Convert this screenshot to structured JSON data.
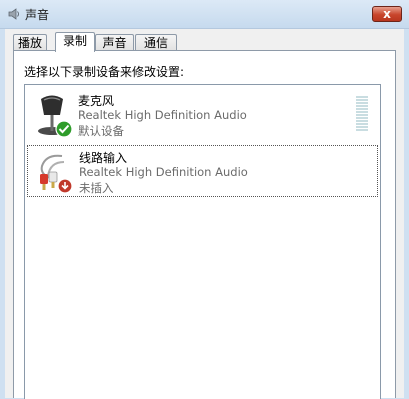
{
  "window": {
    "title": "声音",
    "close_glyph": "x"
  },
  "tabs": [
    {
      "label": "播放",
      "active": false
    },
    {
      "label": "录制",
      "active": true
    },
    {
      "label": "声音",
      "active": false
    },
    {
      "label": "通信",
      "active": false
    }
  ],
  "prompt": "选择以下录制设备来修改设置:",
  "devices": [
    {
      "name": "麦克风",
      "driver": "Realtek High Definition Audio",
      "status": "默认设备",
      "icon": "microphone-icon",
      "badge": "default-device-check-icon"
    },
    {
      "name": "线路输入",
      "driver": "Realtek High Definition Audio",
      "status": "未插入",
      "icon": "line-in-cable-icon",
      "badge": "unplugged-arrow-icon"
    }
  ],
  "colors": {
    "title_bar": "#c6daee",
    "close_button": "#c8452c",
    "default_badge": "#2e9c2a",
    "unplugged_badge": "#c0392b",
    "level_meter": "#c9dde1"
  }
}
